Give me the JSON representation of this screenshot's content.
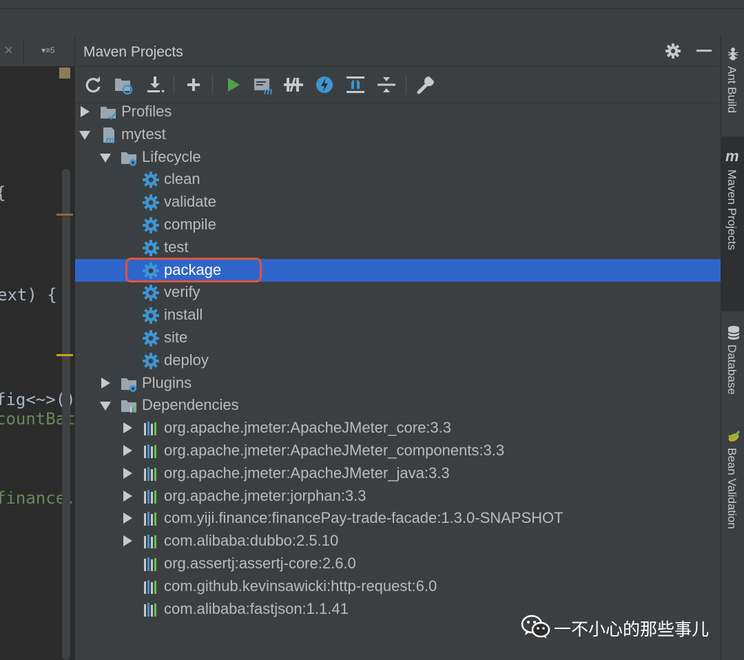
{
  "editor": {
    "menu_label": "▾≡5",
    "code_lines": [
      {
        "text": "{",
        "color": "w"
      },
      {
        "text": "ext) {",
        "color": "w"
      },
      {
        "text": "fig<~>();",
        "color": "w"
      },
      {
        "text": "countBat",
        "color": "g"
      },
      {
        "text": "finance.f",
        "color": "g"
      }
    ]
  },
  "maven": {
    "title": "Maven Projects",
    "toolbar": [
      "refresh-icon",
      "generate-sources-icon",
      "download-icon",
      "add-icon",
      "run-icon",
      "execute-goal-icon",
      "toggle-offline-icon",
      "skip-tests-icon",
      "diagram-icon",
      "expand-all-icon",
      "collapse-all-icon",
      "settings-wrench-icon"
    ],
    "tree": {
      "profiles": "Profiles",
      "project": "mytest",
      "lifecycle": "Lifecycle",
      "goals": [
        "clean",
        "validate",
        "compile",
        "test",
        "package",
        "verify",
        "install",
        "site",
        "deploy"
      ],
      "selected_goal": "package",
      "plugins": "Plugins",
      "dependencies_label": "Dependencies",
      "dependencies": [
        {
          "label": "org.apache.jmeter:ApacheJMeter_core:3.3",
          "expandable": true
        },
        {
          "label": "org.apache.jmeter:ApacheJMeter_components:3.3",
          "expandable": true
        },
        {
          "label": "org.apache.jmeter:ApacheJMeter_java:3.3",
          "expandable": true
        },
        {
          "label": "org.apache.jmeter:jorphan:3.3",
          "expandable": true
        },
        {
          "label": "com.yiji.finance:financePay-trade-facade:1.3.0-SNAPSHOT",
          "expandable": true
        },
        {
          "label": "com.alibaba:dubbo:2.5.10",
          "expandable": true
        },
        {
          "label": "org.assertj:assertj-core:2.6.0",
          "expandable": false
        },
        {
          "label": "com.github.kevinsawicki:http-request:6.0",
          "expandable": false
        },
        {
          "label": "com.alibaba:fastjson:1.1.41",
          "expandable": false
        }
      ]
    }
  },
  "right_tabs": {
    "ant": "Ant Build",
    "maven": "Maven Projects",
    "database": "Database",
    "bean": "Bean Validation"
  },
  "watermark": "一不小心的那些事儿",
  "colors": {
    "selection": "#2f65ca",
    "highlight_box": "#e2533b",
    "gear_blue": "#3d95d4",
    "run_green": "#4fa34a"
  }
}
